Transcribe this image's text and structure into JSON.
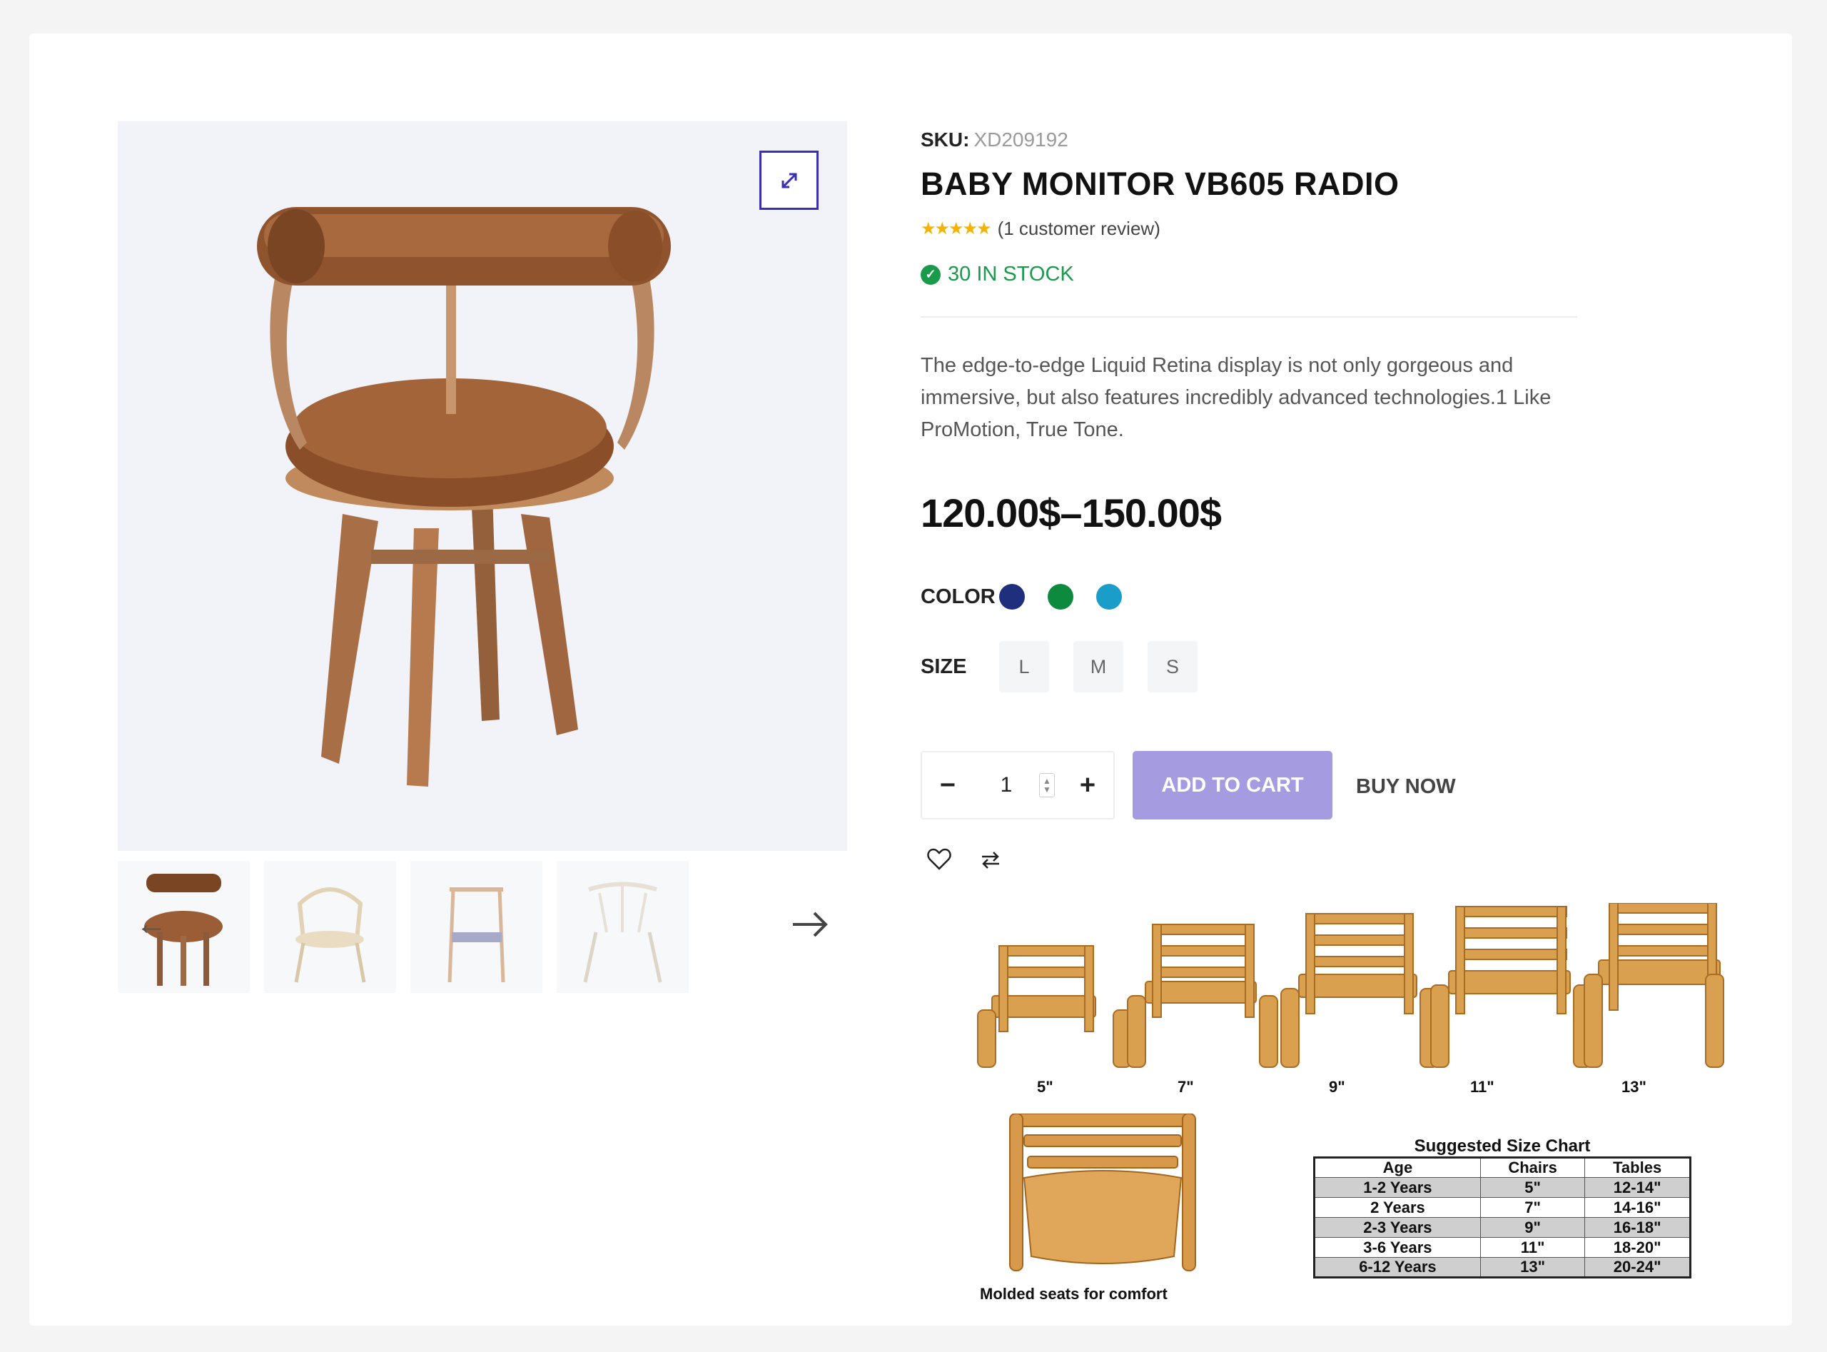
{
  "product": {
    "sku_label": "SKU:",
    "sku_value": "XD209192",
    "title": "BABY MONITOR VB605 RADIO",
    "rating_stars": "★★★★★",
    "review_text": "(1 customer review)",
    "stock_text": "30 IN STOCK",
    "description": "The edge-to-edge Liquid Retina display is not only gorgeous and immersive, but also features incredibly advanced technologies.1 Like ProMotion, True Tone.",
    "price": "120.00$–150.00$",
    "color_label": "COLOR",
    "colors": [
      "#1f2f7e",
      "#0d8a3e",
      "#1a9ec9"
    ],
    "size_label": "SIZE",
    "sizes": [
      "L",
      "M",
      "S"
    ],
    "quantity": "1",
    "add_to_cart": "ADD TO CART",
    "buy_now": "BUY NOW"
  },
  "gallery": {
    "thumbnail_count": 4
  },
  "size_image": {
    "chair_sizes": [
      "5\"",
      "7\"",
      "9\"",
      "11\"",
      "13\""
    ],
    "molded_caption": "Molded seats for comfort",
    "chart_title": "Suggested Size Chart",
    "headers": [
      "Age",
      "Chairs",
      "Tables"
    ],
    "rows": [
      [
        "1-2 Years",
        "5\"",
        "12-14\""
      ],
      [
        "2 Years",
        "7\"",
        "14-16\""
      ],
      [
        "2-3 Years",
        "9\"",
        "16-18\""
      ],
      [
        "3-6 Years",
        "11\"",
        "18-20\""
      ],
      [
        "6-12 Years",
        "13\"",
        "20-24\""
      ]
    ]
  }
}
